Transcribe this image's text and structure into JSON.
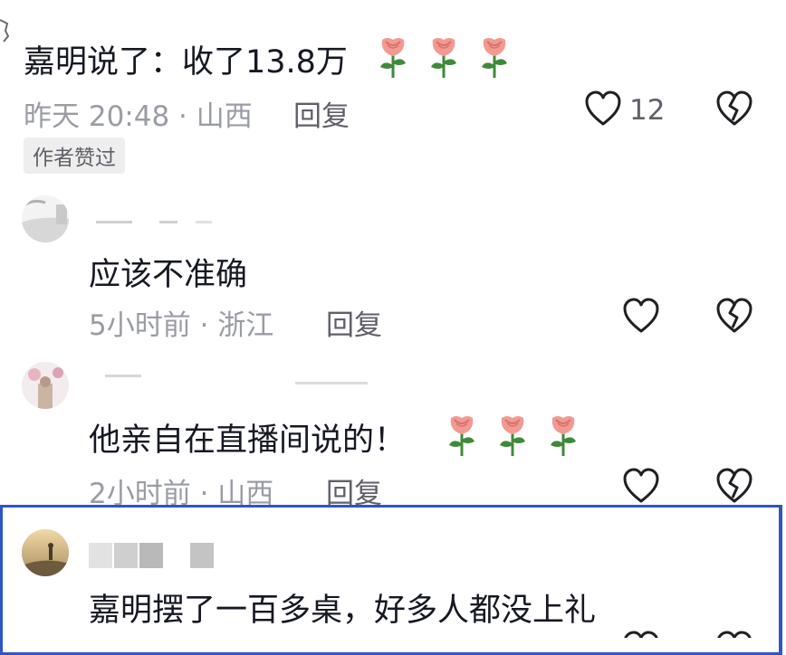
{
  "comments": [
    {
      "text": "嘉明说了：收了13.8万",
      "time": "昨天 20:48",
      "location": "山西",
      "reply": "回复",
      "likes": "12",
      "badge": "作者赞过",
      "emoji": "rose"
    },
    {
      "text": "应该不准确",
      "time": "5小时前",
      "location": "浙江",
      "reply": "回复"
    },
    {
      "text": "他亲自在直播间说的！",
      "time": "2小时前",
      "location": "山西",
      "reply": "回复",
      "emoji": "rose"
    },
    {
      "text": "嘉明摆了一百多桌，好多人都没上礼"
    }
  ],
  "colors": {
    "text": "#161823",
    "meta": "#9a9ca4",
    "highlight": "#2f55c9",
    "rose_petal": "#f29a92",
    "rose_leaf": "#3f8a3a"
  },
  "icons": [
    "heart-outline-icon",
    "broken-heart-icon",
    "rose-emoji-icon"
  ]
}
